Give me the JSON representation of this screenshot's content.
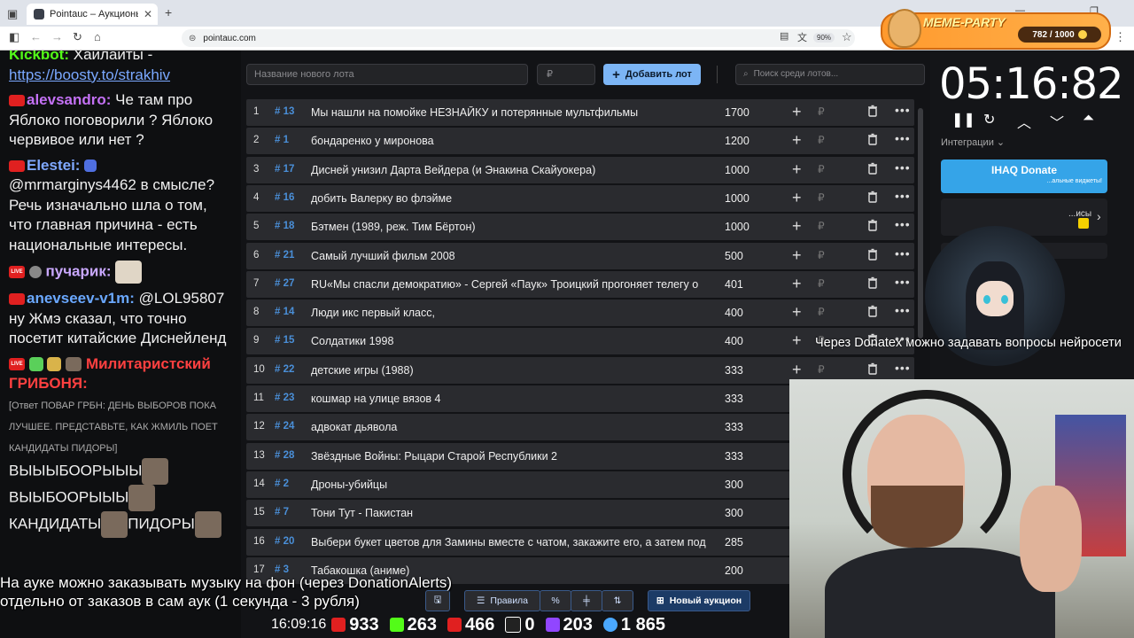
{
  "browser": {
    "tab_title": "Pointauc – Аукционы, лотереи",
    "url": "pointauc.com",
    "zoom": "90%"
  },
  "overlay": {
    "meme_title": "MEME-PARTY",
    "meme_counter": "782 / 1000"
  },
  "chat": {
    "messages": [
      {
        "nick": "Kickbot:",
        "text": "Хайлайты -",
        "link": "https://boosty.to/strakhiv"
      },
      {
        "nick": "alevsandro:",
        "text": "Че там про Яблоко поговорили ? Яблоко червивое или нет ?"
      },
      {
        "nick": "Elestei:",
        "text": "@mrmarginys4462 в смысле? Речь изначально шла о том, что главная причина - есть национальные интересы."
      },
      {
        "nick": "пучарик:"
      },
      {
        "nick": "anevseev-v1m:",
        "text": "@LOL95807 ну Жмэ сказал, что точно посетит китайские Диснейленд"
      },
      {
        "nick": "Милитаристский ГРИБОНЯ:",
        "reply": "[Ответ ПОВАР ГРБН: ДЕНЬ ВЫБОРОВ ПОКА ЛУЧШЕЕ. ПРЕДСТАВЬТЕ, КАК ЖМИЛЬ ПОЕТ КАНДИДАТЫ ПИДОРЫ]",
        "lines": [
          "ВЫЫЫБООРЫЫЫ",
          "ВЫЫБООРЫЫЫ",
          "КАНДИДАТЫ",
          "ПИДОРЫ"
        ]
      }
    ]
  },
  "lots_header": {
    "new_lot_placeholder": "Название нового лота",
    "price_placeholder": "₽",
    "add_button": "Добавить лот",
    "search_placeholder": "Поиск среди лотов..."
  },
  "lots": [
    {
      "n": "1",
      "id": "# 13",
      "name": "Мы нашли на помойке НЕЗНАЙКУ и потерянные мультфильмы",
      "amount": "1700"
    },
    {
      "n": "2",
      "id": "# 1",
      "name": "бондаренко у миронова",
      "amount": "1200"
    },
    {
      "n": "3",
      "id": "# 17",
      "name": "Дисней унизил Дарта Вейдера (и Энакина Скайуокера)",
      "amount": "1000"
    },
    {
      "n": "4",
      "id": "# 16",
      "name": "добить Валерку во флэйме",
      "amount": "1000"
    },
    {
      "n": "5",
      "id": "# 18",
      "name": "Бэтмен (1989, реж. Тим Бёртон)",
      "amount": "1000"
    },
    {
      "n": "6",
      "id": "# 21",
      "name": "Самый лучший фильм 2008",
      "amount": "500"
    },
    {
      "n": "7",
      "id": "# 27",
      "name": "RU«Мы спасли демократию» - Сергей «Паук» Троицкий прогоняет телегу о",
      "amount": "401"
    },
    {
      "n": "8",
      "id": "# 14",
      "name": "Люди икс первый класс,",
      "amount": "400"
    },
    {
      "n": "9",
      "id": "# 15",
      "name": "Солдатики 1998",
      "amount": "400"
    },
    {
      "n": "10",
      "id": "# 22",
      "name": "детские игры (1988)",
      "amount": "333"
    },
    {
      "n": "11",
      "id": "# 23",
      "name": "кошмар на улице вязов 4",
      "amount": "333"
    },
    {
      "n": "12",
      "id": "# 24",
      "name": "адвокат дьявола",
      "amount": "333"
    },
    {
      "n": "13",
      "id": "# 28",
      "name": "Звёздные Войны: Рыцари Старой Республики 2",
      "amount": "333"
    },
    {
      "n": "14",
      "id": "# 2",
      "name": "Дроны-убийцы",
      "amount": "300"
    },
    {
      "n": "15",
      "id": "# 7",
      "name": "Тони Тут - Пакистан",
      "amount": "300"
    },
    {
      "n": "16",
      "id": "# 20",
      "name": "Выбери букет цветов для Замины вместе с чатом, закажите его, а затем под",
      "amount": "285"
    },
    {
      "n": "17",
      "id": "# 3",
      "name": "Табакошка (аниме)",
      "amount": "200"
    }
  ],
  "bottom_toolbar": {
    "rules": "Правила",
    "new_auction": "Новый аукцион"
  },
  "right_panel": {
    "timer": "05:16:82",
    "integrations": "Интеграции",
    "donate_title": "IHAQ Donate",
    "donate_sub": "...альные виджеты!",
    "card2_text": "...исы"
  },
  "tickers": {
    "top": "Через Donatex можно задавать вопросы нейросети",
    "bottom_line1": "На ауке можно заказывать музыку на фон (через DonationAlerts)",
    "bottom_line2": "отдельно от заказов в сам аук (1 секунда - 3 рубля)"
  },
  "stats": {
    "clock": "16:09:16",
    "youtube": "933",
    "kick": "263",
    "live": "466",
    "r": "0",
    "twitch": "203",
    "viewers": "1 865"
  },
  "colors": {
    "accent_blue": "#7cb5f5",
    "id_blue": "#4a8fd8",
    "row_bg": "#2a2b2f",
    "youtube_red": "#e02020",
    "kick_green": "#53fc18"
  }
}
